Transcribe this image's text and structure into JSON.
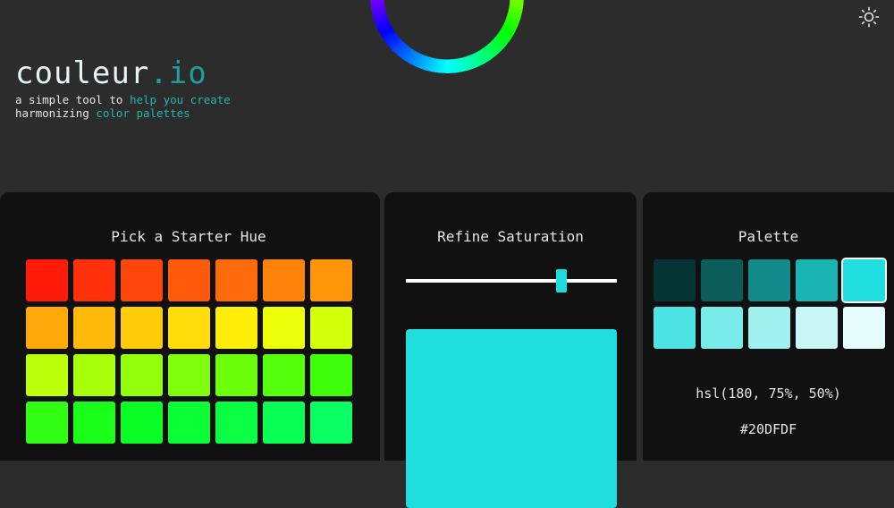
{
  "brand": {
    "name_main": "couleur",
    "name_ext": ".io"
  },
  "tagline": {
    "line1_a": "a simple tool to ",
    "line1_b": "help you create",
    "line2_a": "harmonizing ",
    "line2_b": "color palettes"
  },
  "hue_panel": {
    "title": "Pick a Starter Hue",
    "rows": [
      [
        "#ff1a0a",
        "#ff300a",
        "#ff460a",
        "#ff5a0a",
        "#ff6a0a",
        "#ff820a",
        "#ff960a"
      ],
      [
        "#ffa80a",
        "#ffba0a",
        "#ffcc0a",
        "#ffdc0a",
        "#ffee0a",
        "#ecff0a",
        "#d4ff0a"
      ],
      [
        "#bcff0a",
        "#a8ff0a",
        "#94ff0a",
        "#80ff0a",
        "#6cff0a",
        "#56ff0a",
        "#40ff0a"
      ],
      [
        "#30ff14",
        "#1aff1a",
        "#0aff24",
        "#0aff34",
        "#0aff44",
        "#0aff54",
        "#0aff64"
      ]
    ]
  },
  "saturation_panel": {
    "title": "Refine Saturation",
    "value_percent": 75,
    "preview_color": "#21dede"
  },
  "palette_panel": {
    "title": "Palette",
    "rows": [
      [
        "#043434",
        "#0c5c5c",
        "#138a8a",
        "#1ab3b3",
        "#21dede"
      ],
      [
        "#4ee4e4",
        "#79ebeb",
        "#a1f1f1",
        "#c9f7f7",
        "#e6fbfb"
      ]
    ],
    "selected_index": 4,
    "hsl_text": "hsl(180, 75%, 50%)",
    "hex_text": "#20DFDF"
  },
  "colors": {
    "accent": "#21dcdc",
    "background": "#2c2c2c",
    "panel": "#111111"
  },
  "icons": {
    "theme_toggle": "sun-icon"
  }
}
